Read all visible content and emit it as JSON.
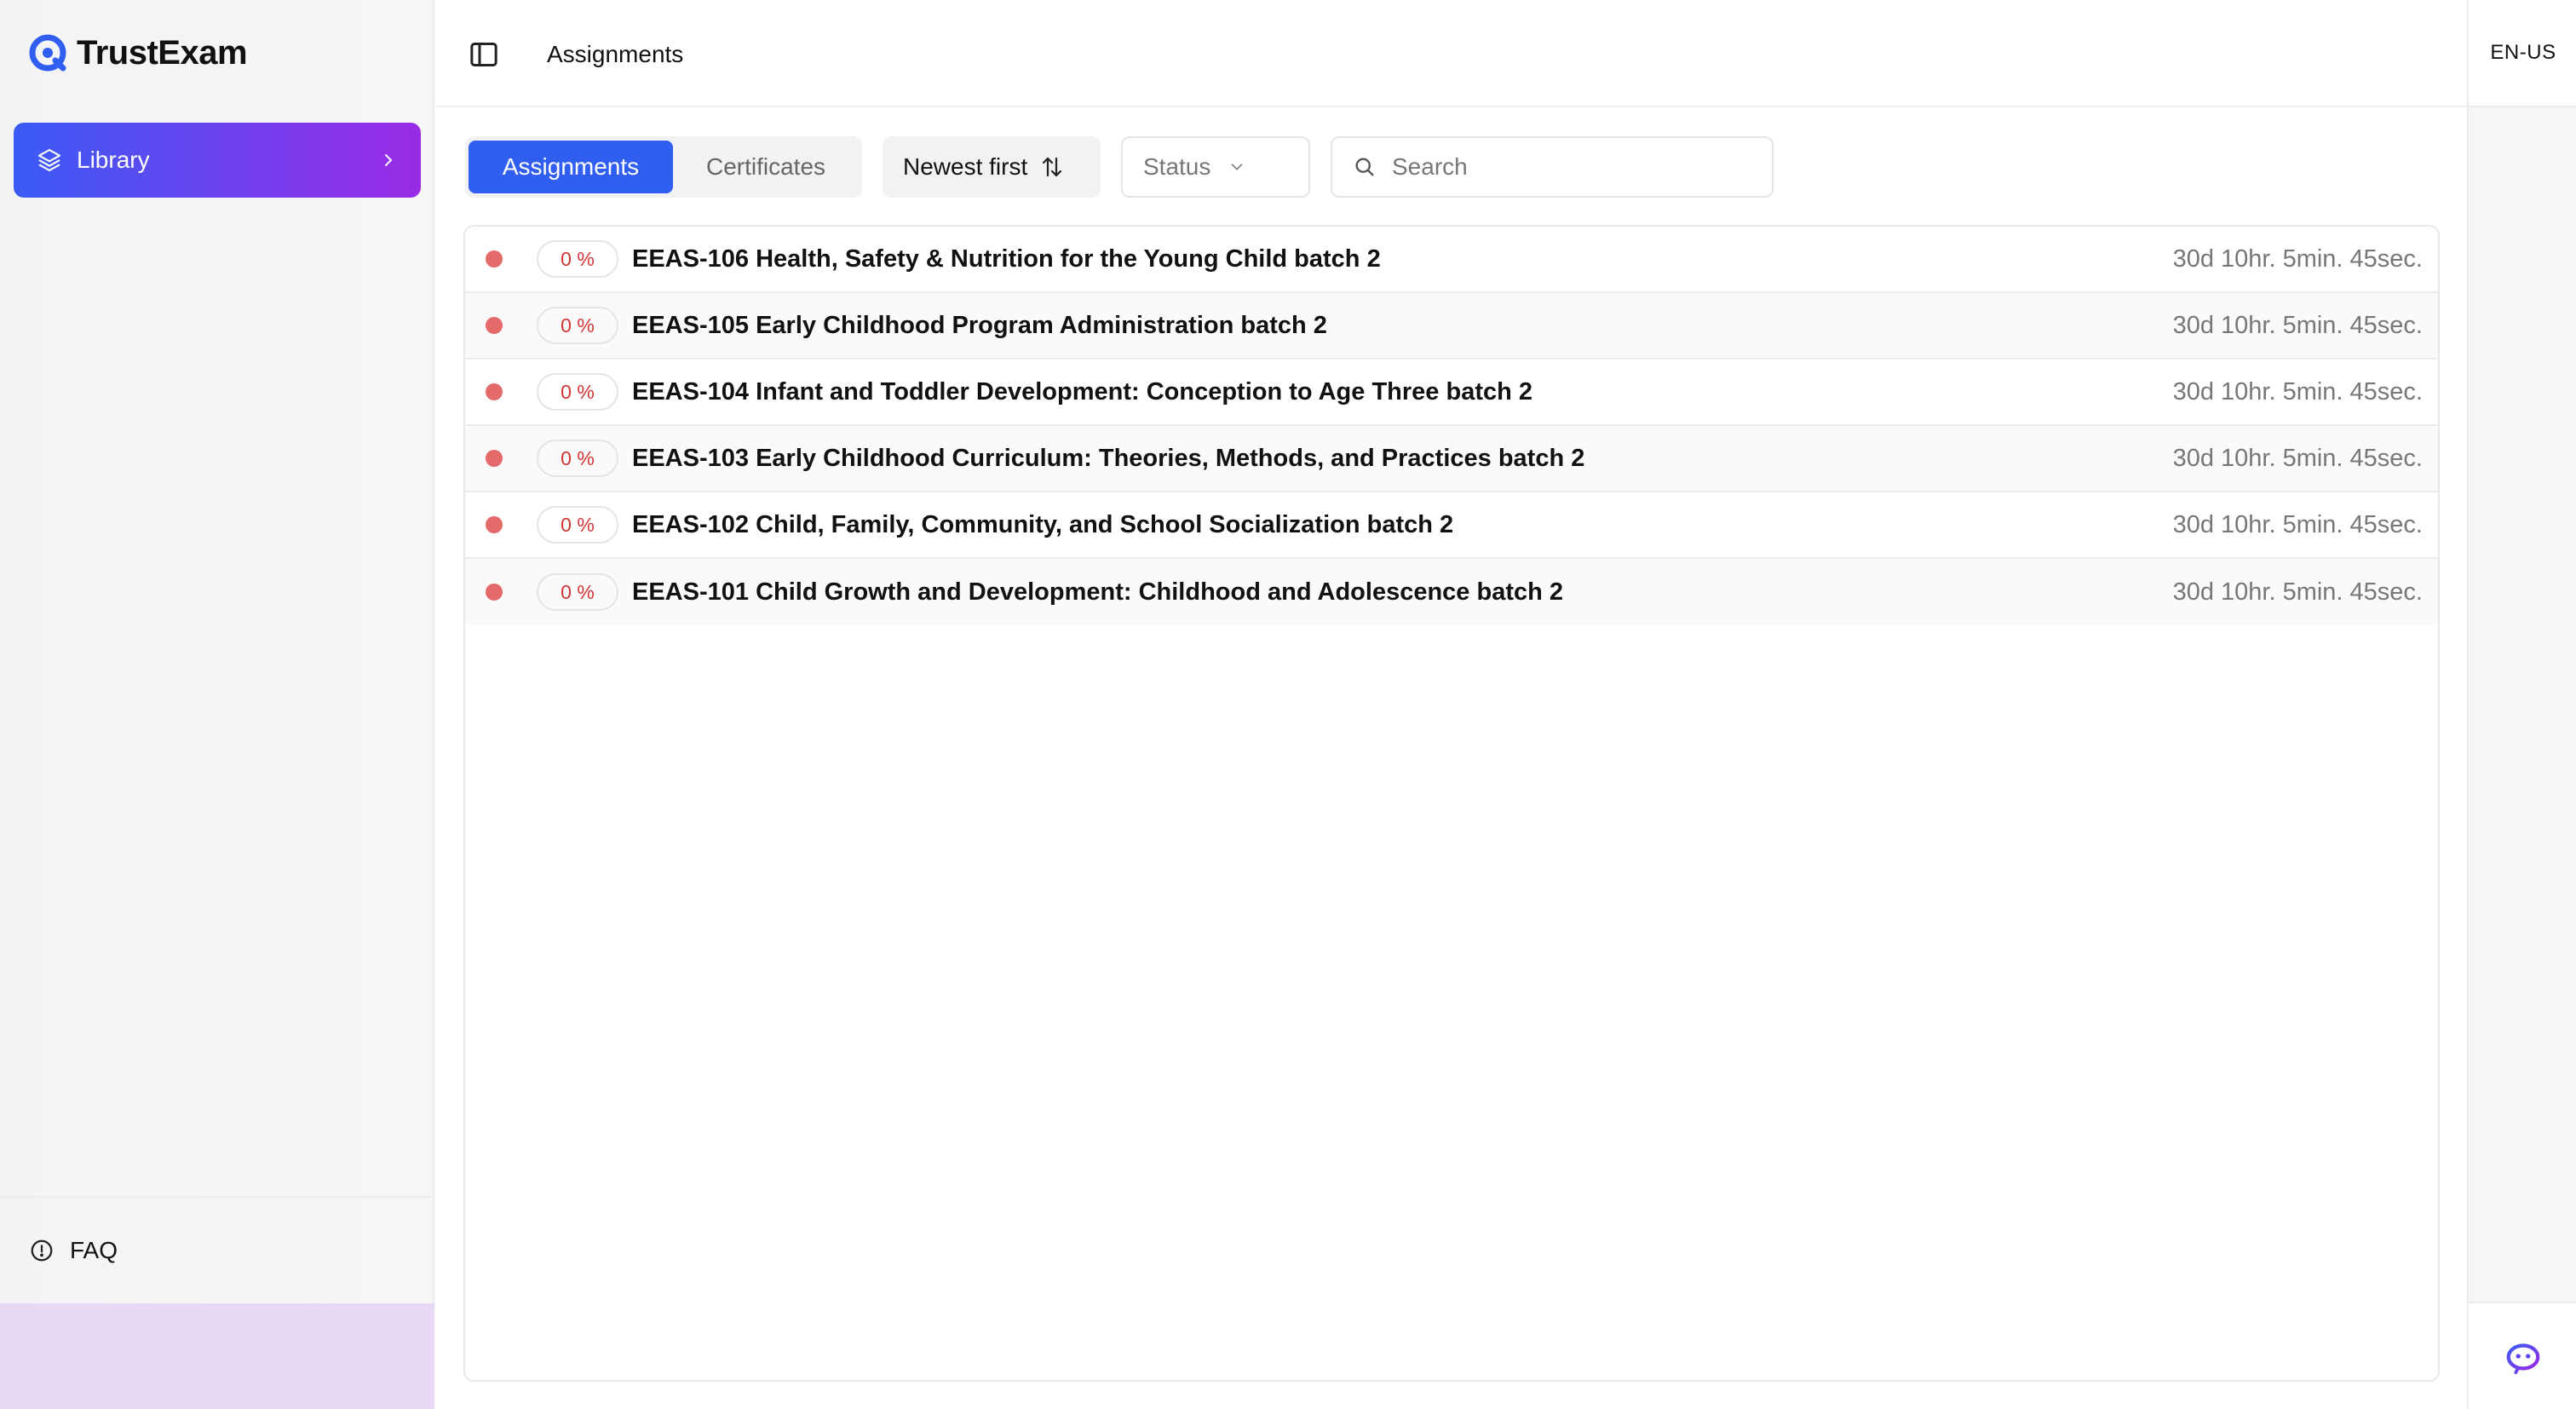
{
  "app": {
    "name": "TrustExam"
  },
  "sidebar": {
    "nav": [
      {
        "label": "Library",
        "icon": "layers-icon"
      }
    ],
    "footer": {
      "faq_label": "FAQ"
    }
  },
  "header": {
    "title": "Assignments"
  },
  "language": "EN-US",
  "toolbar": {
    "tabs": [
      {
        "label": "Assignments",
        "active": true
      },
      {
        "label": "Certificates",
        "active": false
      }
    ],
    "sort_label": "Newest first",
    "status_placeholder": "Status",
    "search_placeholder": "Search"
  },
  "assignments": [
    {
      "progress": "0 %",
      "title": "EEAS-106 Health, Safety & Nutrition for the Young Child batch 2",
      "time_left": "30d 10hr. 5min. 45sec.",
      "status_color": "#e46a6a"
    },
    {
      "progress": "0 %",
      "title": "EEAS-105 Early Childhood Program Administration batch 2",
      "time_left": "30d 10hr. 5min. 45sec.",
      "status_color": "#e46a6a"
    },
    {
      "progress": "0 %",
      "title": "EEAS-104 Infant and Toddler Development: Conception to Age Three batch 2",
      "time_left": "30d 10hr. 5min. 45sec.",
      "status_color": "#e46a6a"
    },
    {
      "progress": "0 %",
      "title": "EEAS-103 Early Childhood Curriculum: Theories, Methods, and Practices batch 2",
      "time_left": "30d 10hr. 5min. 45sec.",
      "status_color": "#e46a6a"
    },
    {
      "progress": "0 %",
      "title": "EEAS-102 Child, Family, Community, and School Socialization batch 2",
      "time_left": "30d 10hr. 5min. 45sec.",
      "status_color": "#e46a6a"
    },
    {
      "progress": "0 %",
      "title": "EEAS-101 Child Growth and Development: Childhood and Adolescence batch 2",
      "time_left": "30d 10hr. 5min. 45sec.",
      "status_color": "#e46a6a"
    }
  ],
  "colors": {
    "accent": "#2f5ef0",
    "gradient_start": "#3b5bf6",
    "gradient_end": "#9a2be6",
    "danger": "#d33434"
  }
}
